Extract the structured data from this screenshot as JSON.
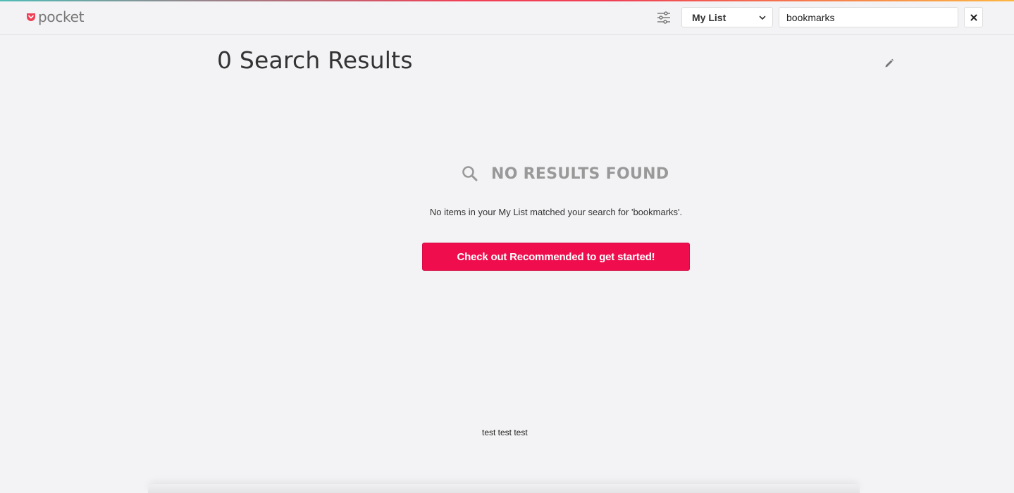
{
  "app": {
    "logo_text": "pocket",
    "brand_color": "#ef4056"
  },
  "header": {
    "filter_icon": "sliders-icon",
    "list_select": {
      "selected": "My List"
    },
    "search": {
      "value": "bookmarks"
    },
    "clear_icon": "close-icon"
  },
  "main": {
    "title": "0 Search Results",
    "edit_icon": "pencil-icon",
    "empty_state": {
      "heading": "NO RESULTS FOUND",
      "message": "No items in your My List matched your search for 'bookmarks'.",
      "cta_label": "Check out Recommended to get started!",
      "cta_color": "#ef0d4d"
    }
  },
  "footer": {
    "text": "test test test"
  }
}
